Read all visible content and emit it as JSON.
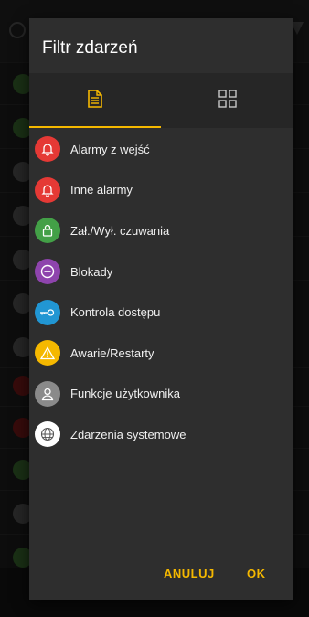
{
  "dialog": {
    "title": "Filtr zdarzeń",
    "tabs": [
      {
        "name": "document-icon",
        "active": true
      },
      {
        "name": "grid-icon",
        "active": false
      }
    ],
    "items": [
      {
        "label": "Alarmy z wejść",
        "color": "#e53935",
        "icon": "bell-icon"
      },
      {
        "label": "Inne alarmy",
        "color": "#e53935",
        "icon": "bell-icon"
      },
      {
        "label": "Zał./Wył. czuwania",
        "color": "#43a047",
        "icon": "lock-icon"
      },
      {
        "label": "Blokady",
        "color": "#8e44ad",
        "icon": "block-icon"
      },
      {
        "label": "Kontrola dostępu",
        "color": "#2196d3",
        "icon": "key-icon"
      },
      {
        "label": "Awarie/Restarty",
        "color": "#f5b800",
        "icon": "warning-icon"
      },
      {
        "label": "Funkcje użytkownika",
        "color": "#8a8a8a",
        "icon": "user-icon"
      },
      {
        "label": "Zdarzenia systemowe",
        "color": "#ffffff",
        "icon": "globe-icon"
      }
    ],
    "cancel_label": "ANULUJ",
    "ok_label": "OK"
  },
  "colors": {
    "accent": "#f5b800"
  }
}
